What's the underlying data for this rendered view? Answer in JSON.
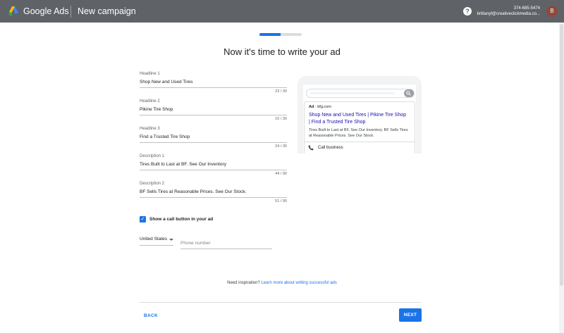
{
  "header": {
    "brand": "Google Ads",
    "campaign_title": "New campaign",
    "help_icon": "?",
    "account_phone": "374-685-5474",
    "account_email": "brittanyf@creativeclickmedia.co...",
    "avatar_initial": "B"
  },
  "progress": {
    "fraction": 0.5
  },
  "page_title": "Now it's time to write your ad",
  "fields": [
    {
      "label": "Headline 1",
      "value": "Shop New and Used Tires",
      "count": "23 / 30"
    },
    {
      "label": "Headline 2",
      "value": "Pikine Tire Shop",
      "count": "16 / 30"
    },
    {
      "label": "Headline 3",
      "value": "Find a Trusted Tire Shop",
      "count": "24 / 30"
    },
    {
      "label": "Description 1",
      "value": "Tires Built to Last at BF. See Our Inventory",
      "count": "44 / 90"
    },
    {
      "label": "Description 2",
      "value": "BF Sells Tires at Reasonable Prices. See Our Stock.",
      "count": "51 / 90"
    }
  ],
  "call_button": {
    "label": "Show a call button in your ad",
    "checked": true
  },
  "country": {
    "value": "United States"
  },
  "phone": {
    "placeholder": "Phone number"
  },
  "preview": {
    "ad_badge": "Ad",
    "ad_url": "· bfg.com",
    "headline": "Shop New and Used Tires | Pikine Tire Shop | Find a Trusted Tire Shop",
    "description": "Tires Built to Last at BF. See Our Inventory. BF Sells Tires at Reasonable Prices. See Our Stock.",
    "call_label": "Call business"
  },
  "inspiration": {
    "text": "Need inspiration?",
    "link": "Learn more about writing successful ads"
  },
  "footer": {
    "back_label": "BACK",
    "next_label": "NEXT"
  },
  "colors": {
    "header_bg": "#5f6368",
    "accent": "#1a73e8",
    "link": "#1a0dab"
  },
  "icons": {
    "logo": "google-ads-logo-icon",
    "help": "help-icon",
    "search": "search-icon",
    "call": "phone-icon",
    "caret": "chevron-down-icon"
  }
}
